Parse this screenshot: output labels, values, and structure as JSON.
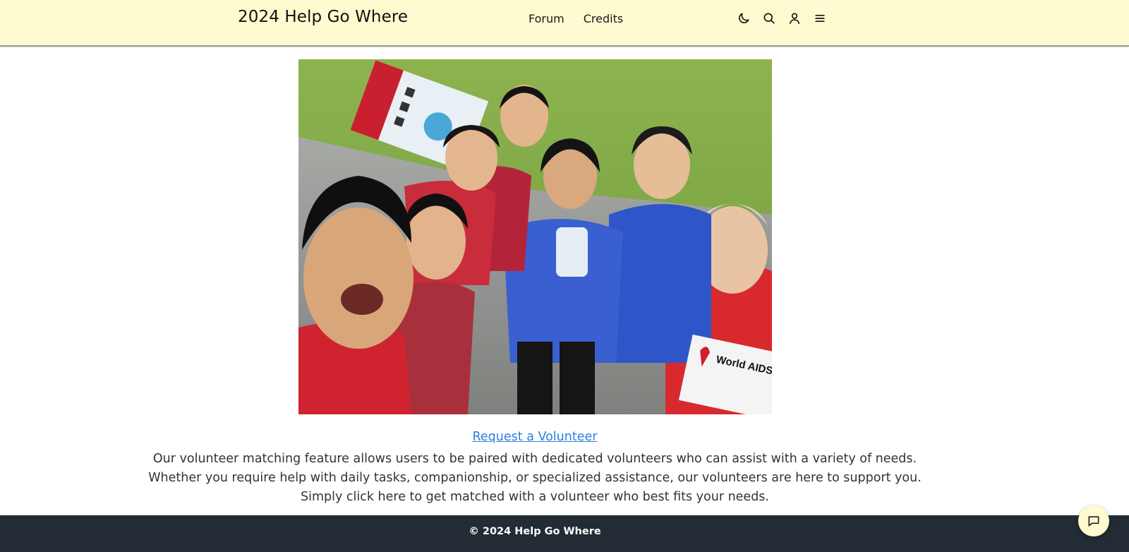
{
  "header": {
    "brand": "2024 Help Go Where",
    "nav": [
      {
        "label": "Forum"
      },
      {
        "label": "Credits"
      }
    ],
    "icons": [
      "moon-icon",
      "search-icon",
      "user-icon",
      "menu-icon"
    ],
    "background": "#fefbd0"
  },
  "main": {
    "image_alt": "Volunteers taking a group selfie at a World AIDS Day event",
    "sign_text": "World AIDS D",
    "cta_link": "Request a Volunteer",
    "description": [
      "Our volunteer matching feature allows users to be paired with dedicated volunteers who can assist with a variety of needs.",
      "Whether you require help with daily tasks, companionship, or specialized assistance, our volunteers are here to support you.",
      "Simply click here to get matched with a volunteer who best fits your needs."
    ]
  },
  "footer": {
    "text": "© 2024 Help Go Where",
    "background": "#232b35"
  },
  "chat": {
    "icon": "chat-icon"
  },
  "colors": {
    "link": "#2f7fe0",
    "accent": "#fefbd0"
  }
}
